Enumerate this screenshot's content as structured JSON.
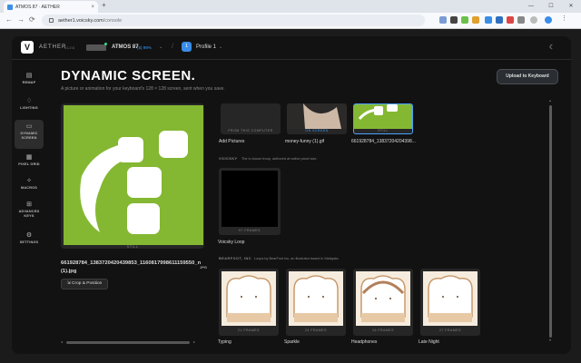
{
  "browser": {
    "tab_title": "ATMOS 87 · AETHER",
    "tab_close": "×",
    "new_tab": "+",
    "url_host": "aether1.voicsky.com",
    "url_path": "/console",
    "back": "←",
    "forward": "→",
    "reload": "⟳",
    "window_controls": [
      "—",
      "☐",
      "✕"
    ]
  },
  "app": {
    "brand": "AETHER",
    "version": "v1.2.6",
    "logo_letter": "V",
    "device_name": "ATMOS 87",
    "battery": "(5) 99%",
    "profile_number": "1",
    "profile_name": "Profile 1",
    "chevron": "⌄",
    "divider": "/",
    "theme_toggle_icon": "☾"
  },
  "sidebar": {
    "items": [
      {
        "label": "REMAP",
        "icon": "▤"
      },
      {
        "label": "LIGHTING",
        "icon": "♢"
      },
      {
        "label": "DYNAMIC SCREEN",
        "icon": "▭",
        "active": true
      },
      {
        "label": "PIXEL GRID",
        "icon": "▦"
      },
      {
        "label": "MACROS",
        "icon": "✧"
      },
      {
        "label": "ADVANCED KEYS",
        "icon": "⊞"
      },
      {
        "label": "SETTINGS",
        "icon": "⚙"
      }
    ]
  },
  "page": {
    "title": "DYNAMIC SCREEN.",
    "subtitle": "A picture or animation for your keyboard's 128 × 128 screen, sent when you save.",
    "upload_button": "Upload to Keyboard"
  },
  "preview": {
    "label": "STILL",
    "filename": "661928784_1383720420439853_1160817998611159550_n (1).jpg",
    "file_ext": "JPG",
    "crop_button": "Crop & Position",
    "crop_icon": "⇲"
  },
  "library": {
    "top_row": [
      {
        "caption": "FROM THIS COMPUTER",
        "name": "Add Pictures"
      },
      {
        "caption": "ON SCREEN",
        "name": "money-funny (1).gif"
      },
      {
        "caption": "STILL",
        "name": "661928784_13837204204398..."
      }
    ],
    "voicsky_section": {
      "name": "VOICSKY",
      "desc": "The in-house troop, authored at native panel size.",
      "items": [
        {
          "caption": "97 FRAMES",
          "name": "Voicsky Loop"
        }
      ]
    },
    "bearfoot_section": {
      "name": "BEARFOOT, INC",
      "desc": "Loops by BearFoot Inc, an illustrator based in Malaysia.",
      "items": [
        {
          "caption": "21 FRAMES",
          "name": "Typing"
        },
        {
          "caption": "24 FRAMES",
          "name": "Sparkle"
        },
        {
          "caption": "16 FRAMES",
          "name": "Headphones"
        },
        {
          "caption": "27 FRAMES",
          "name": "Late Night"
        }
      ]
    }
  },
  "scrollbars": {
    "left_arrow": "◂",
    "right_arrow": "▸",
    "up_arrow": "▴",
    "down_arrow": "▾"
  },
  "colors": {
    "accent": "#3a8de6",
    "on_screen_caption": "#3a9dff",
    "preview_green": "#84b832",
    "selected_border": "#4aa3ff"
  }
}
